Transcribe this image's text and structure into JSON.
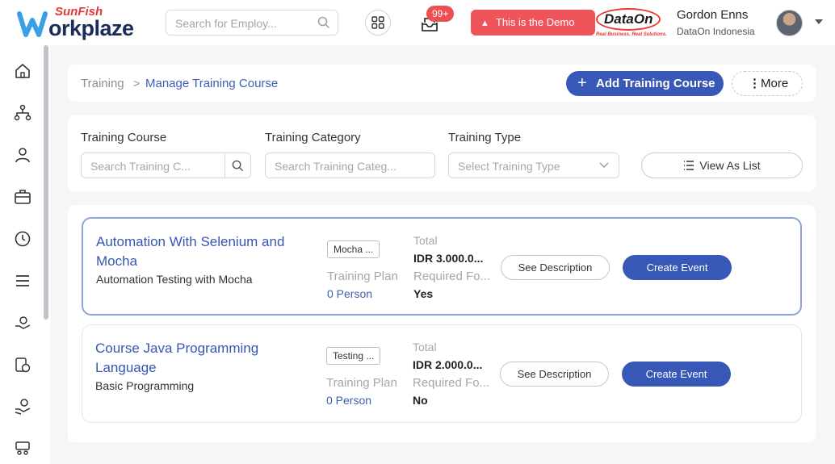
{
  "brand": {
    "logo_top": "SunFish",
    "logo_main": "orkplaze",
    "partner_name": "DataOn",
    "partner_tagline": "Real Business. Real Solutions."
  },
  "header": {
    "search_placeholder": "Search for Employ...",
    "notification_badge": "99+",
    "demo_label": "This is the Demo",
    "user_name": "Gordon Enns",
    "user_company": "DataOn Indonesia"
  },
  "breadcrumb": {
    "root": "Training",
    "separator": ">",
    "current": "Manage Training Course"
  },
  "actions": {
    "add_label": "Add Training Course",
    "more_label": "More"
  },
  "filters": {
    "course_label": "Training Course",
    "course_placeholder": "Search Training C...",
    "category_label": "Training Category",
    "category_placeholder": "Search Training Categ...",
    "type_label": "Training Type",
    "type_placeholder": "Select Training Type",
    "view_label": "View As List"
  },
  "courses": [
    {
      "title": "Automation With Selenium and Mocha",
      "subtitle": "Automation Testing with Mocha",
      "tag": "Mocha ...",
      "plan_label": "Training Plan",
      "plan_value": "0 Person",
      "total_label": "Total",
      "total_value": "IDR 3.000.0...",
      "required_label": "Required Fo...",
      "required_value": "Yes",
      "desc_label": "See Description",
      "event_label": "Create Event"
    },
    {
      "title": "Course Java Programming Language",
      "subtitle": "Basic Programming",
      "tag": "Testing ...",
      "plan_label": "Training Plan",
      "plan_value": "0 Person",
      "total_label": "Total",
      "total_value": "IDR 2.000.0...",
      "required_label": "Required Fo...",
      "required_value": "No",
      "desc_label": "See Description",
      "event_label": "Create Event"
    }
  ],
  "colors": {
    "primary": "#3858b7",
    "link": "#3557b3",
    "danger": "#f0545b"
  }
}
